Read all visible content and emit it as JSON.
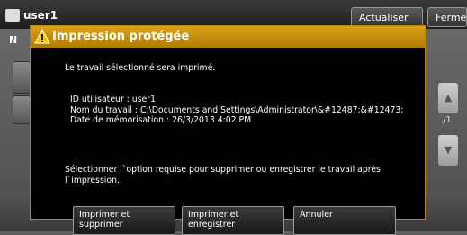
{
  "background": {
    "user": "user1",
    "refresh_label": "Actualiser",
    "close_label": "Fermer",
    "left_letter": "N",
    "page_fraction": "/1"
  },
  "dialog": {
    "title": "Impression protégée",
    "message": "Le travail sélectionné sera imprimé.",
    "info": {
      "user_id": "ID utilisateur : user1",
      "job_name": "Nom du travail : C:\\Documents and Settings\\Administrator\\&#12487;&#12473;",
      "stored_date": "Date de mémorisation : 26/3/2013 4:02 PM"
    },
    "instruction_line1": "Sélectionner l`option requise pour supprimer ou enregistrer le travail après",
    "instruction_line2": "l`impression.",
    "buttons": {
      "print_delete_line1": "Imprimer et",
      "print_delete_line2": "supprimer",
      "print_save_line1": "Imprimer et",
      "print_save_line2": "enregistrer",
      "cancel": "Annuler"
    }
  },
  "colors": {
    "title_bar": "#c48f0a",
    "dialog_bg": "#000000"
  }
}
